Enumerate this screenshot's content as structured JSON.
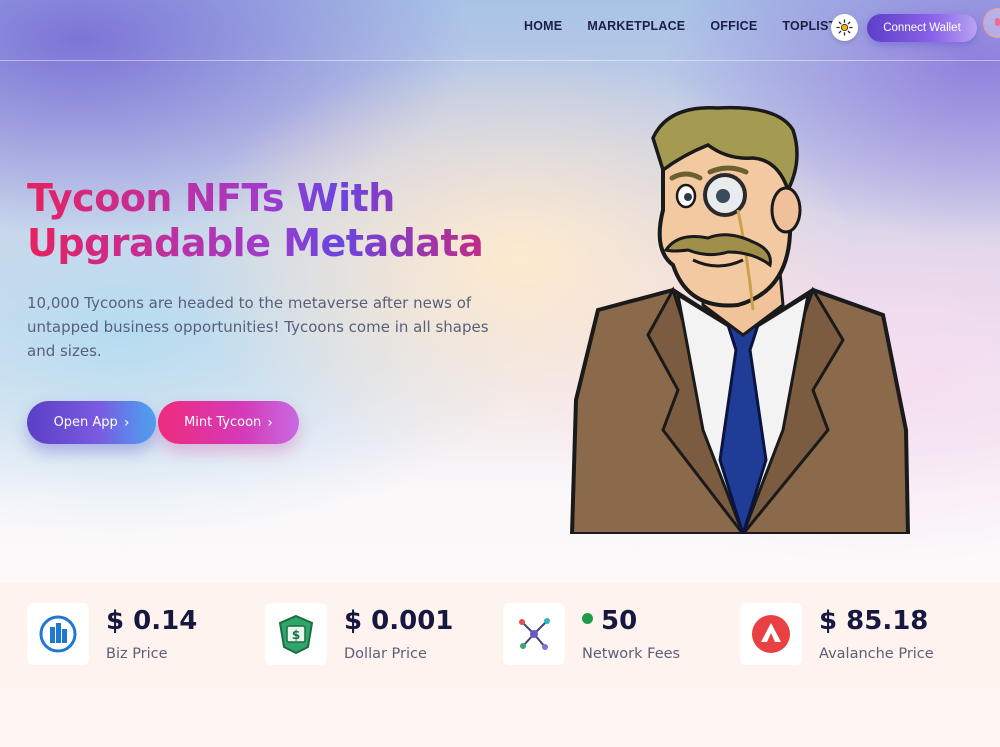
{
  "nav": {
    "items": [
      "HOME",
      "MARKETPLACE",
      "OFFICE",
      "TOPLIST"
    ],
    "theme_icon": "sun-icon",
    "connect_label": "Connect Wallet"
  },
  "hero": {
    "title_line1": "Tycoon NFTs With",
    "title_line2": "Upgradable Metadata",
    "description": "10,000 Tycoons are headed to the metaverse after news of untapped business opportunities! Tycoons come in all shapes and sizes.",
    "buttons": [
      {
        "label": "Open App",
        "icon": "chevron-right-icon"
      },
      {
        "label": "Mint Tycoon",
        "icon": "chevron-right-icon"
      }
    ],
    "image": "tycoon-character-illustration"
  },
  "stats": [
    {
      "value": "$ 0.14",
      "label": "Biz Price",
      "icon": "building-icon"
    },
    {
      "value": "$ 0.001",
      "label": "Dollar Price",
      "icon": "dollar-bill-icon"
    },
    {
      "value": "50",
      "label": "Network Fees",
      "icon": "network-nodes-icon",
      "status_color": "#1e9b47"
    },
    {
      "value": "$ 85.18",
      "label": "Avalanche Price",
      "icon": "avalanche-logo-icon"
    }
  ],
  "colors": {
    "accent_pink": "#e8215f",
    "accent_purple": "#6a45e0",
    "navy_text": "#16183f"
  }
}
